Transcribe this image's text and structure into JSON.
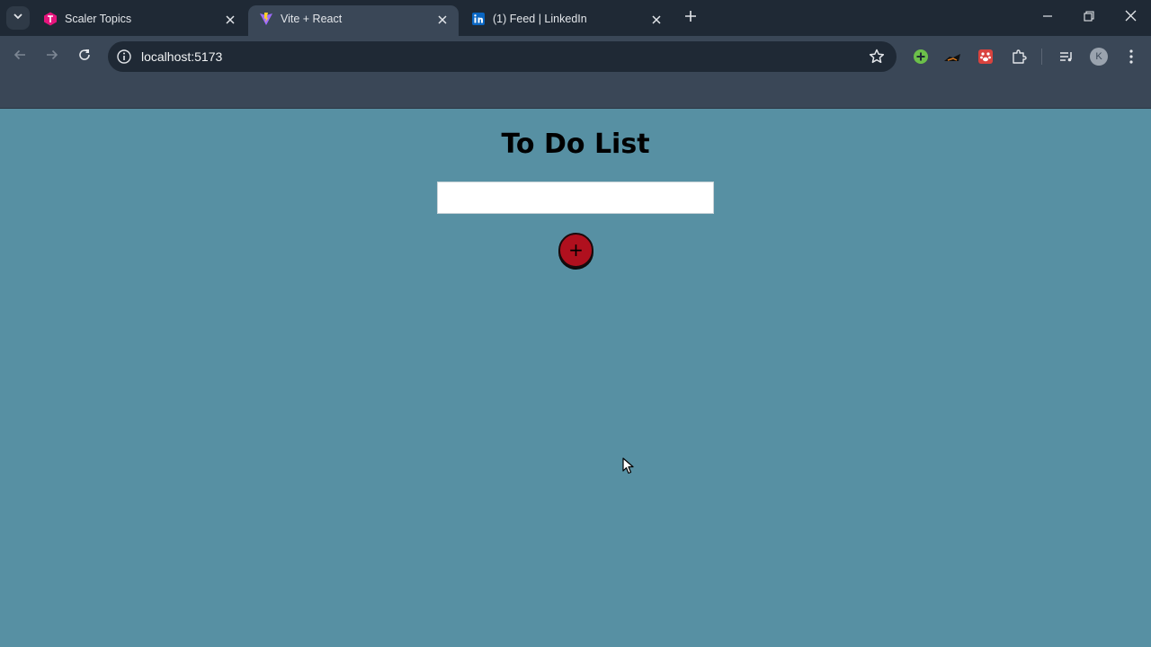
{
  "browser": {
    "tabs": [
      {
        "title": "Scaler Topics",
        "state": "inactive",
        "icon": "scaler-topics-favicon"
      },
      {
        "title": "Vite + React",
        "state": "active",
        "icon": "vite-favicon"
      },
      {
        "title": "(1) Feed | LinkedIn",
        "state": "inactive",
        "icon": "linkedin-favicon"
      }
    ],
    "address_bar": {
      "url": "localhost:5173"
    },
    "colors": {
      "tabstrip": "#1f2935",
      "toolbar": "#3a4757",
      "omnibox": "#1f2935"
    }
  },
  "app": {
    "title": "To Do List",
    "input": {
      "value": "",
      "placeholder": ""
    },
    "add_button": {
      "label": "+"
    },
    "colors": {
      "background": "#5790a3",
      "button": "#b0101e"
    }
  }
}
